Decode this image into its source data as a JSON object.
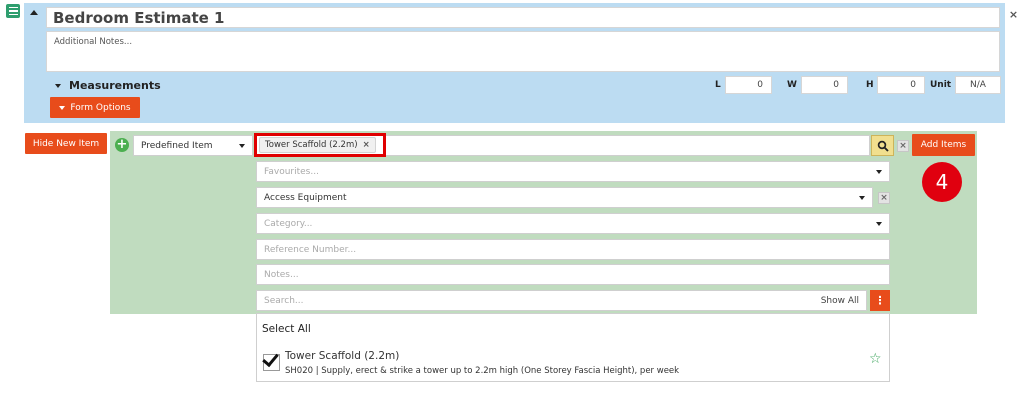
{
  "estimate": {
    "title": "Bedroom Estimate 1",
    "notes_placeholder": "Additional Notes..."
  },
  "measurements": {
    "label": "Measurements",
    "L_label": "L",
    "L_value": "0",
    "W_label": "W",
    "W_value": "0",
    "H_label": "H",
    "H_value": "0",
    "unit_label": "Unit",
    "unit_value": "N/A"
  },
  "buttons": {
    "form_options": "Form Options",
    "hide_new_item": "Hide New Item",
    "add_items": "Add Items"
  },
  "new_item": {
    "type_select": "Predefined Item",
    "selected_tag": "Tower Scaffold (2.2m)",
    "favourites_placeholder": "Favourites...",
    "group_value": "Access Equipment",
    "category_placeholder": "Category...",
    "reference_placeholder": "Reference Number...",
    "notes_placeholder": "Notes...",
    "search_placeholder": "Search...",
    "show_all": "Show All"
  },
  "step_badge": "4",
  "results": {
    "select_all": "Select All",
    "items": [
      {
        "name": "Tower Scaffold (2.2m)",
        "description": "SH020 | Supply, erect & strike a tower up to 2.2m high (One Storey Fascia Height), per week",
        "checked": true
      }
    ]
  },
  "colors": {
    "panel_blue": "#bcdcf2",
    "panel_green": "#c0dcbf",
    "accent_orange": "#e84c1b",
    "highlight_red": "#e00000"
  }
}
